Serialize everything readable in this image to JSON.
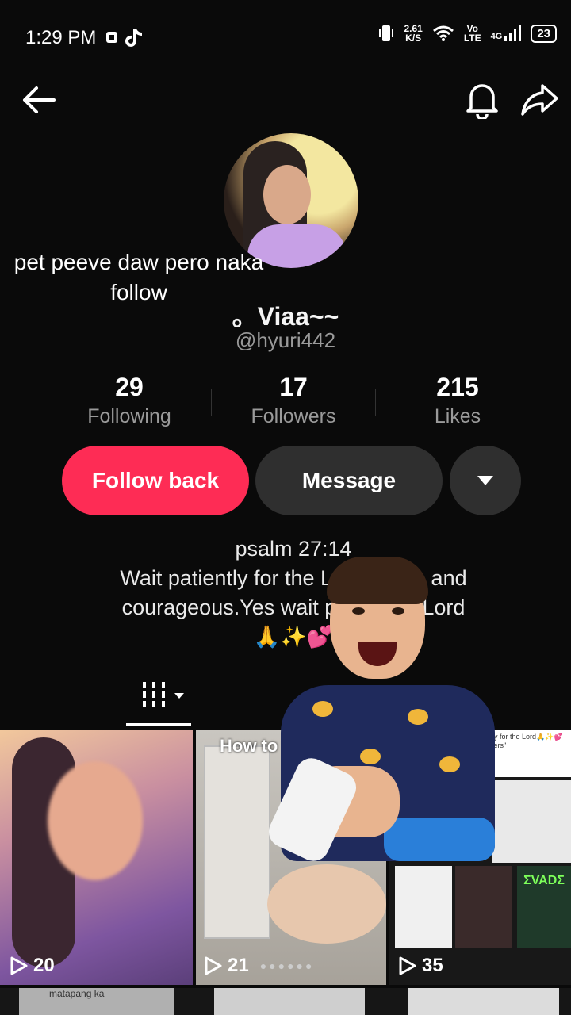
{
  "status_bar": {
    "time": "1:29 PM",
    "net_speed_value": "2.61",
    "net_speed_unit": "K/S",
    "volte_top": "Vo",
    "volte_bottom": "LTE",
    "network": "4G",
    "battery": "23"
  },
  "overlay_text": "pet peeve daw pero naka follow",
  "profile": {
    "name": "。Viaa~~",
    "handle": "@hyuri442"
  },
  "stats": [
    {
      "value": "29",
      "label": "Following"
    },
    {
      "value": "17",
      "label": "Followers"
    },
    {
      "value": "215",
      "label": "Likes"
    }
  ],
  "buttons": {
    "follow_back": "Follow back",
    "message": "Message"
  },
  "bio": {
    "line1": "psalm 27:14",
    "line2": "Wait patiently for the Lo— brave and",
    "line3": "courageous.Yes wait pati— the Lord",
    "line4": "🙏✨💕"
  },
  "videos": [
    {
      "views": "20"
    },
    {
      "views": "21",
      "title": "How to t… Idi…"
    },
    {
      "views": "35"
    }
  ],
  "mini_texts": {
    "bio_snippet": "patiently for the Lord🙏✨💕",
    "orders": "our orders\"",
    "evade": "ΣVADΣ",
    "row2_left": "matapang ka"
  },
  "colors": {
    "accent": "#fe2c55",
    "background": "#0a0a0a",
    "secondary_button": "#2f2f2f"
  }
}
